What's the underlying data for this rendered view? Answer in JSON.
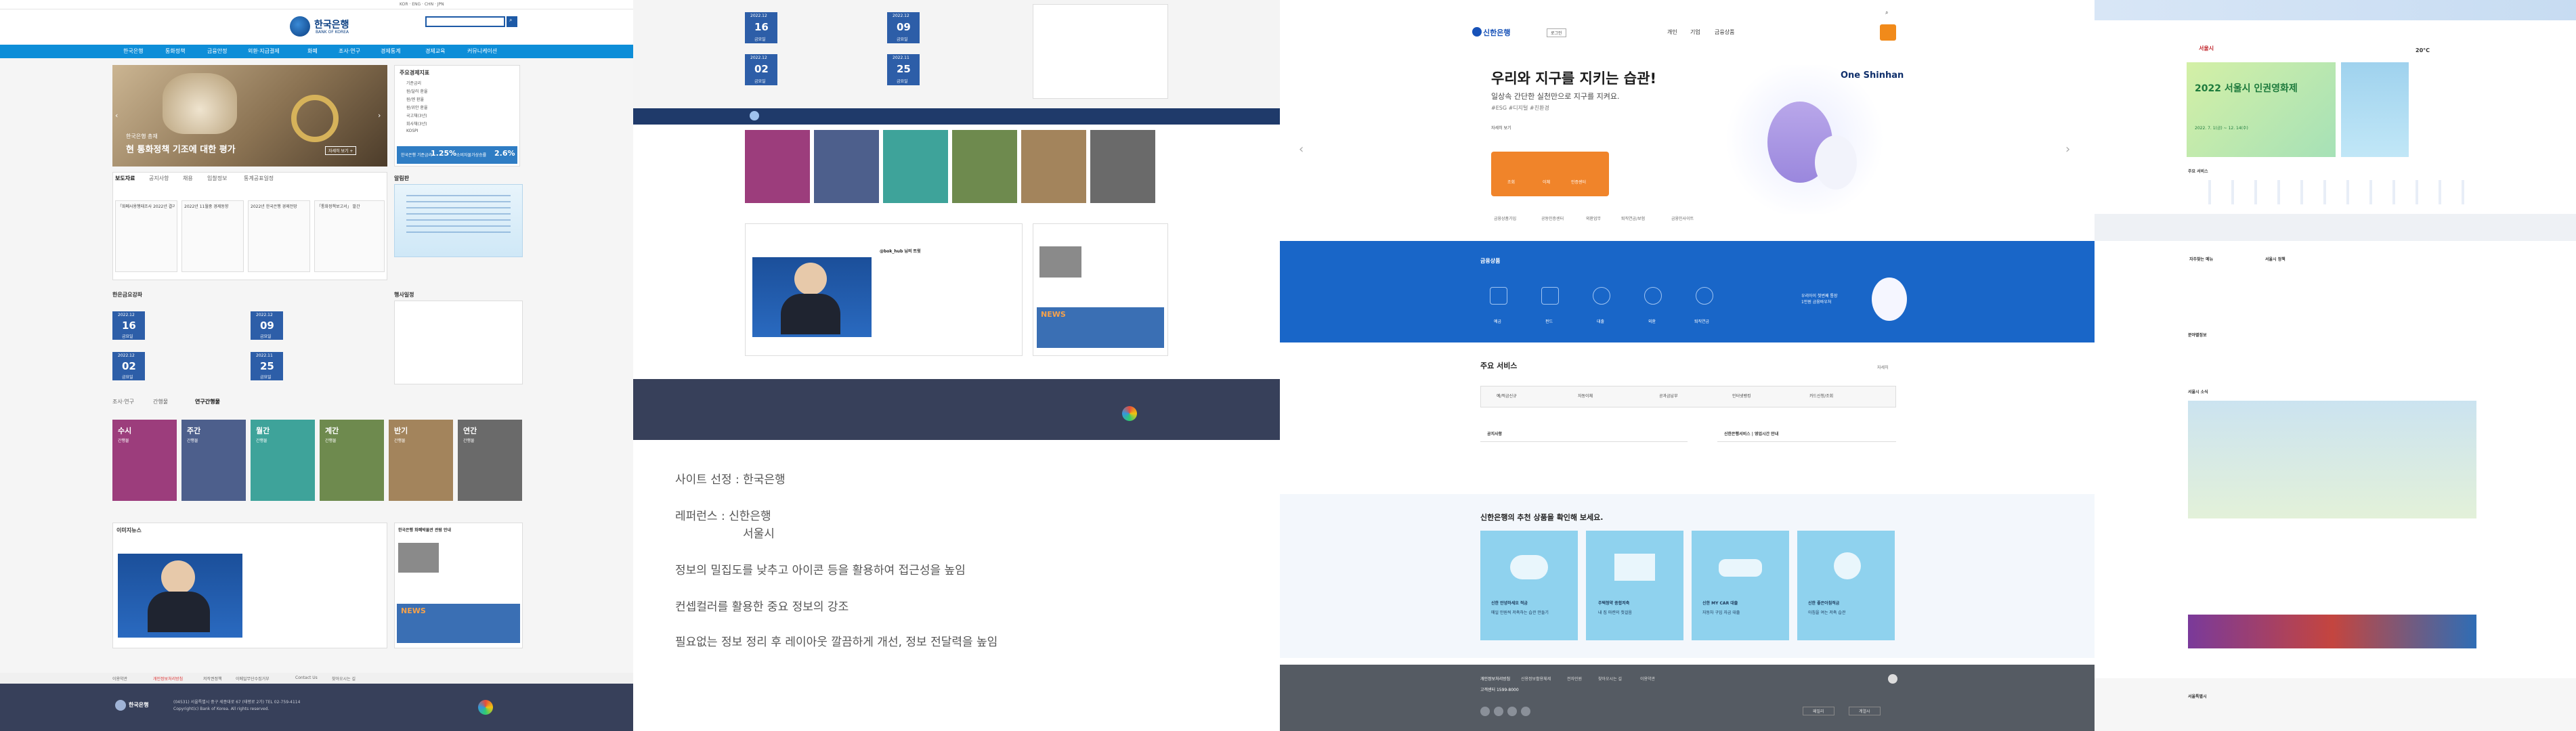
{
  "p1": {
    "brand": "한국은행",
    "brand_en": "BANK OF KOREA",
    "nav": [
      "한국은행",
      "통화정책",
      "금융안정",
      "외환·지급결제",
      "화폐",
      "조사·연구",
      "경제통계",
      "경제교육",
      "커뮤니케이션"
    ],
    "hero": {
      "tag": "한국은행 총재",
      "headline": "현 통화정책 기조에 대한 평가",
      "more": "자세히 보기 +"
    },
    "indicators": {
      "title": "주요경제지표",
      "rows": [
        "기준금리",
        "원/달러 환율",
        "원/엔 환율",
        "원/위안 환율",
        "국고채(3년)",
        "회사채(3년)",
        "KOSPI"
      ],
      "base_label": "한국은행 기준금리",
      "base_value": "1.25%",
      "cpi_label": "소비자물가상승률",
      "cpi_value": "2.6%"
    },
    "tabs": [
      "보도자료",
      "공지사항",
      "채용",
      "입찰정보",
      "통계공표일정"
    ],
    "news_cards": [
      "「화폐사용행태조사 2022년 결과」",
      "2022년 11월중 경제동향",
      "2022년 한국은행 경제전망",
      "「통화정책보고서」 발간"
    ],
    "popup_title": "알림판",
    "calendar": {
      "title": "한은금요강좌",
      "dates": [
        {
          "d": "2022.12",
          "n": "16",
          "w": "금요일"
        },
        {
          "d": "2022.12",
          "n": "02",
          "w": "금요일"
        },
        {
          "d": "2022.12",
          "n": "09",
          "w": "금요일"
        },
        {
          "d": "2022.11",
          "n": "25",
          "w": "금요일"
        }
      ]
    },
    "schedule_title": "행사일정",
    "pub_tabs": [
      "조사·연구",
      "간행물",
      "연구간행물"
    ],
    "pubs": [
      {
        "t": "수시",
        "s": "간행물"
      },
      {
        "t": "주간",
        "s": "간행물"
      },
      {
        "t": "월간",
        "s": "간행물"
      },
      {
        "t": "계간",
        "s": "간행물"
      },
      {
        "t": "반기",
        "s": "간행물"
      },
      {
        "t": "연간",
        "s": "간행물"
      }
    ],
    "media_title": "이미지뉴스",
    "bok_title": "한국은행 화폐박물관 관람 안내",
    "news_badge": "NEWS",
    "footer_links": [
      "이용약관",
      "개인정보처리방침",
      "저작권정책",
      "이메일무단수집거부",
      "Contact Us",
      "찾아오시는 길"
    ],
    "footer_addr": "(04531) 서울특별시 중구 세종대로 67 (태평로 2가) TEL 02-759-4114",
    "footer_copy": "Copyright(c) Bank of Korea. All rights reserved."
  },
  "p2": {
    "subtitles": [
      "사이트 선정 : 한국은행",
      "레퍼런스 : 신한은행",
      "서울시",
      "정보의 밀집도를 낮추고 아이콘 등을 활용하여 접근성을 높임",
      "컨셉컬러를 활용한 중요 정보의 강조",
      "필요없는 정보 정리 후 레이아웃 깔끔하게 개선, 정보 전달력을 높임"
    ],
    "dates": [
      {
        "d": "2022.12",
        "n": "16",
        "w": "금요일"
      },
      {
        "d": "2022.12",
        "n": "09",
        "w": "금요일"
      },
      {
        "d": "2022.12",
        "n": "02",
        "w": "금요일"
      },
      {
        "d": "2022.11",
        "n": "25",
        "w": "금요일"
      }
    ],
    "handle": "@bok_hub 님의 트윗",
    "news_badge": "NEWS"
  },
  "p3": {
    "brand": "신한은행",
    "login": "로그인",
    "top_links": [
      "개인",
      "기업",
      "금융상품"
    ],
    "hero_title": "우리와 지구를 지키는 습관!",
    "hero_sub": "일상속 간단한 실천만으로 지구를 지켜요.",
    "hero_tag": "#ESG #디지털 #친환경",
    "hero_more": "자세히 보기",
    "hero_btns": [
      "조회",
      "이체",
      "인증센터"
    ],
    "brand_art": "One Shinhan",
    "sub_links": [
      "금융상품가입",
      "공동인증센터",
      "외환업무",
      "퇴직연금/보험",
      "금융인사이트"
    ],
    "product_title": "금융상품",
    "products": [
      "예금",
      "펀드",
      "대출",
      "외환",
      "퇴직연금"
    ],
    "promo": "우리아이 첫번째 통장\n1만원 금융바우처",
    "services_title": "주요 서비스",
    "services_more": "자세히",
    "services": [
      "예/적금신규",
      "자동이체",
      "공과금납부",
      "인터넷뱅킹",
      "카드신청/조회"
    ],
    "notice_tab": "공지사항",
    "notice_right": "신한은행서비스 | 영업시간 안내",
    "reco_title": "신한은행의 추천 상품을 확인해 보세요.",
    "reco": [
      {
        "title": "신한 안녕하세요 적금",
        "desc": "매일 만원씩 저축하는 습관 만들기"
      },
      {
        "title": "주택청약 종합저축",
        "desc": "내 집 마련의 첫걸음"
      },
      {
        "title": "신한 MY CAR 대출",
        "desc": "자동차 구입 자금 대출"
      },
      {
        "title": "신한 좋은아침적금",
        "desc": "아침을 여는 저축 습관"
      }
    ],
    "footer_links": [
      "개인정보처리방침",
      "신용정보활용체제",
      "전자민원",
      "찾아오시는 길",
      "이용약관"
    ],
    "footer_phone": "고객센터 1599-8000",
    "footer_btns": [
      "패밀리",
      "계열사"
    ]
  },
  "p4": {
    "brand": "서울시",
    "banner": "2022 서울시 인권영화제",
    "banner_date": "2022. 7. 1(금) ~ 12. 14(수)",
    "weather": "20°C",
    "section1": "주요 서비스",
    "sections": [
      "자주찾는 메뉴",
      "서울시 정책",
      "분야별정보",
      "서울시 소식"
    ],
    "footer_brand": "서울특별시"
  }
}
